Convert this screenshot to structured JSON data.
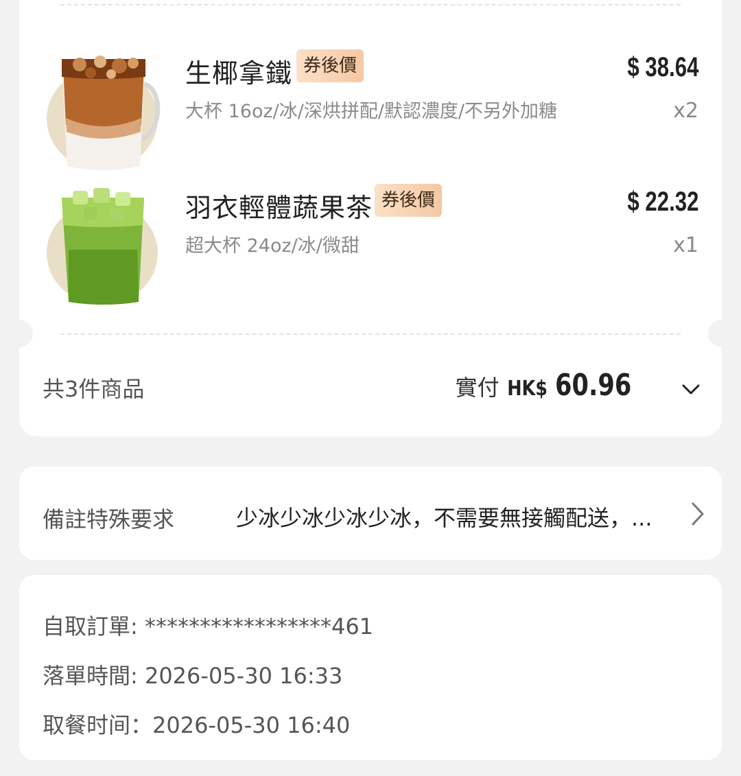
{
  "order": {
    "items": [
      {
        "name": "生椰拿鐵",
        "badge": "券後價",
        "spec": "大杯 16oz/冰/深烘拼配/默認濃度/不另外加糖",
        "price": "$ 38.64",
        "qty": "x2"
      },
      {
        "name": "羽衣輕體蔬果茶",
        "badge": "券後價",
        "spec": "超大杯 24oz/冰/微甜",
        "price": "$ 22.32",
        "qty": "x1"
      }
    ],
    "summary": {
      "count_text": "共3件商品",
      "pay_label": "實付",
      "currency": "HK$",
      "amount": "60.96"
    }
  },
  "note": {
    "label": "備註特殊要求",
    "text": "少冰少冰少冰少冰，不需要無接觸配送，..."
  },
  "info": {
    "pickup_order": "自取訂單: *****************461",
    "order_time": "落單時間:  2026-05-30 16:33",
    "pickup_time": "取餐时间：2026-05-30 16:40"
  },
  "icons": {
    "expand": "chevron-down-icon",
    "note_arrow": "chevron-right-icon"
  }
}
